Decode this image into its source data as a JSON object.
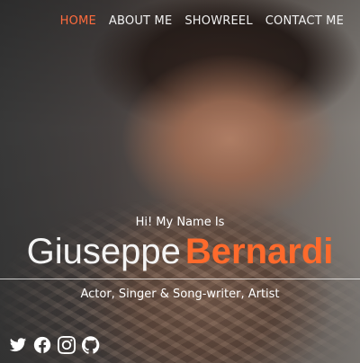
{
  "nav": {
    "items": [
      {
        "label": "HOME",
        "active": true
      },
      {
        "label": "ABOUT ME",
        "active": false
      },
      {
        "label": "SHOWREEL",
        "active": false
      },
      {
        "label": "CONTACT ME",
        "active": false
      }
    ],
    "active_color": "#ff6b3d"
  },
  "hero": {
    "greeting": "Hi! My Name Is",
    "first_name": "Giuseppe",
    "last_name": "Bernardi",
    "tagline": "Actor, Singer & Song-writer, Artist",
    "accent_color": "#ff6a2c"
  },
  "socials": {
    "icons": [
      "twitter-icon",
      "facebook-icon",
      "instagram-icon",
      "github-icon"
    ]
  }
}
